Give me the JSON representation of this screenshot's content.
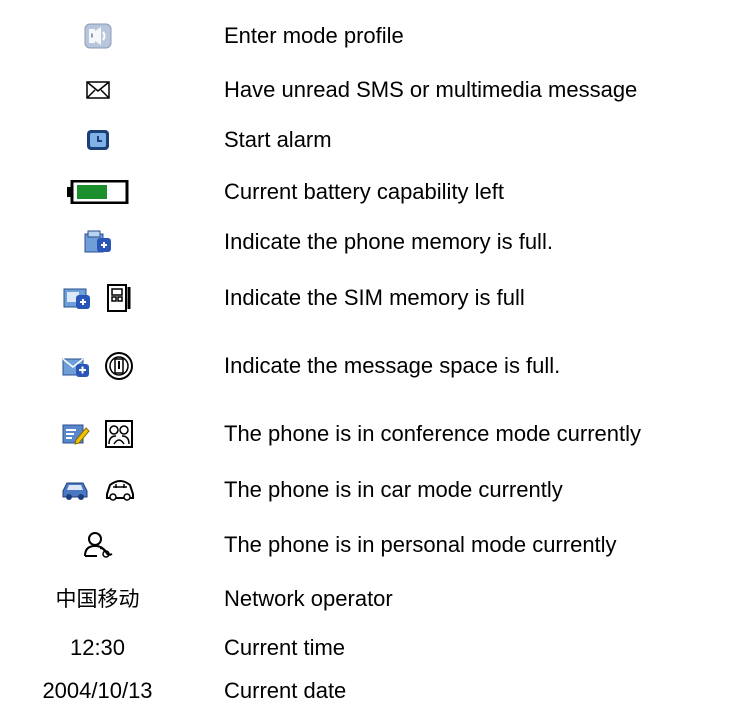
{
  "rows": [
    {
      "icons": [
        "profile-mode-icon"
      ],
      "desc": "Enter mode profile"
    },
    {
      "icons": [
        "envelope-icon"
      ],
      "desc": "Have unread SMS or multimedia message"
    },
    {
      "icons": [
        "alarm-clock-icon"
      ],
      "desc": "Start alarm"
    },
    {
      "icons": [
        "battery-icon"
      ],
      "desc": "Current battery capability left"
    },
    {
      "icons": [
        "phone-memory-full-icon"
      ],
      "desc": "Indicate the phone memory is full."
    },
    {
      "icons": [
        "sim-memory-full-icon",
        "sim-card-icon"
      ],
      "desc": "Indicate the SIM memory is full"
    },
    {
      "icons": [
        "message-space-full-icon",
        "message-full-outline-icon"
      ],
      "desc": "Indicate the message space is full."
    },
    {
      "icons": [
        "conference-mode-icon",
        "conference-mode-outline-icon"
      ],
      "desc": "The phone is in conference mode currently"
    },
    {
      "icons": [
        "car-mode-icon",
        "car-mode-outline-icon"
      ],
      "desc": "The phone is in car mode currently"
    },
    {
      "icons": [
        "personal-mode-icon"
      ],
      "desc": "The phone is in personal mode currently"
    },
    {
      "label": "中国移动",
      "desc": "Network operator"
    },
    {
      "label": "12:30",
      "desc": "Current time"
    },
    {
      "label": "2004/10/13",
      "desc": "Current date"
    }
  ],
  "colors": {
    "icon_blue": "#3b6fc4",
    "battery_green": "#1a8f2c",
    "edit_yellow": "#f5c400"
  }
}
